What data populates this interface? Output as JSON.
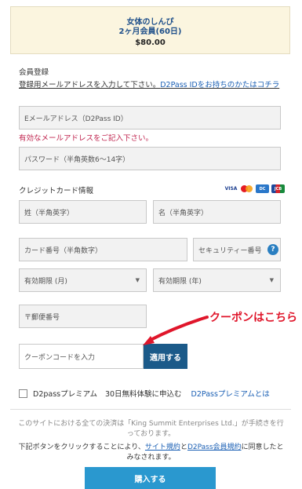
{
  "banner": {
    "product": "女体のしんぴ",
    "plan": "2ヶ月会員(60日)",
    "price": "$80.00"
  },
  "membership": {
    "heading": "会員登録",
    "note": "登録用メールアドレスを入力して下さい。",
    "note_link": "D2Pass IDをお持ちのかたはコチラ",
    "email_placeholder": "Eメールアドレス（D2Pass ID）",
    "email_error": "有効なメールアドレスをご記入下さい。",
    "password_placeholder": "パスワード（半角英数6～14字）"
  },
  "credit": {
    "heading": "クレジットカード情報",
    "card_brands": [
      "VISA",
      "Mastercard",
      "Diners",
      "JCB"
    ],
    "last_name_placeholder": "姓（半角英字）",
    "first_name_placeholder": "名（半角英字）",
    "card_number_placeholder": "カード番号（半角数字）",
    "security_code_placeholder": "セキュリティー番号",
    "help_icon": "?",
    "expiry_month": "有効期限 (月)",
    "expiry_year": "有効期限 (年)",
    "postal_placeholder": "〒郵便番号"
  },
  "coupon": {
    "placeholder": "クーポンコードを入力",
    "apply_label": "適用する",
    "annotation": "クーポンはこちら"
  },
  "premium": {
    "label": "D2passプレミアム",
    "offer": "30日無料体験に申込む",
    "link": "D2Passプレミアムとは"
  },
  "legal": {
    "notice": "このサイトにおける全ての決済は「King Summit Enterprises Ltd.」が手続きを行っております。",
    "agree_prefix": "下記ボタンをクリックすることにより、",
    "terms_link": "サイト規約",
    "and": "と",
    "member_terms_link": "D2Pass会員規約",
    "agree_suffix": "に同意したとみなされます。"
  },
  "buy_label": "購入する",
  "colors": {
    "accent": "#2a98cf",
    "apply_button": "#1b5a89",
    "error": "#c0254f",
    "annotation": "#e0162b",
    "banner_bg": "#fbf5df"
  }
}
